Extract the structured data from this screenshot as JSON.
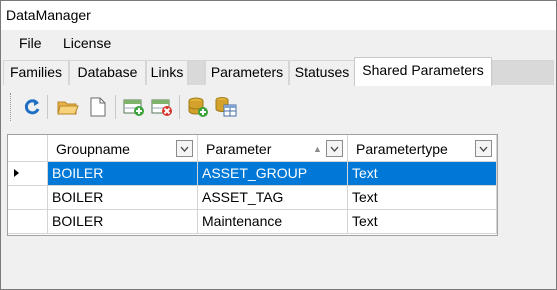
{
  "window": {
    "title": "DataManager"
  },
  "menu": [
    {
      "label": "File"
    },
    {
      "label": "License"
    }
  ],
  "tabs": [
    {
      "label": "Families",
      "active": false
    },
    {
      "label": "Database",
      "active": false
    },
    {
      "label": "Links",
      "active": false
    },
    {
      "label": "Parameters",
      "active": false
    },
    {
      "label": "Statuses",
      "active": false
    },
    {
      "label": "Shared Parameters",
      "active": true
    }
  ],
  "toolbar": [
    {
      "icon": "refresh-icon"
    },
    {
      "icon": "open-folder-icon"
    },
    {
      "icon": "new-document-icon"
    },
    {
      "icon": "add-row-icon"
    },
    {
      "icon": "delete-row-icon"
    },
    {
      "icon": "add-database-icon"
    },
    {
      "icon": "database-table-icon"
    }
  ],
  "grid": {
    "columns": [
      {
        "label": "Groupname",
        "sort": ""
      },
      {
        "label": "Parameter",
        "sort": "ascending"
      },
      {
        "label": "Parametertype",
        "sort": ""
      }
    ],
    "rows": [
      {
        "selected": true,
        "cells": [
          "BOILER",
          "ASSET_GROUP",
          "Text"
        ]
      },
      {
        "selected": false,
        "cells": [
          "BOILER",
          "ASSET_TAG",
          "Text"
        ]
      },
      {
        "selected": false,
        "cells": [
          "BOILER",
          "Maintenance",
          "Text"
        ]
      }
    ]
  },
  "colors": {
    "selection": "#0078d7",
    "chrome": "#f0f0f0",
    "active_tab": "#ffffff"
  }
}
